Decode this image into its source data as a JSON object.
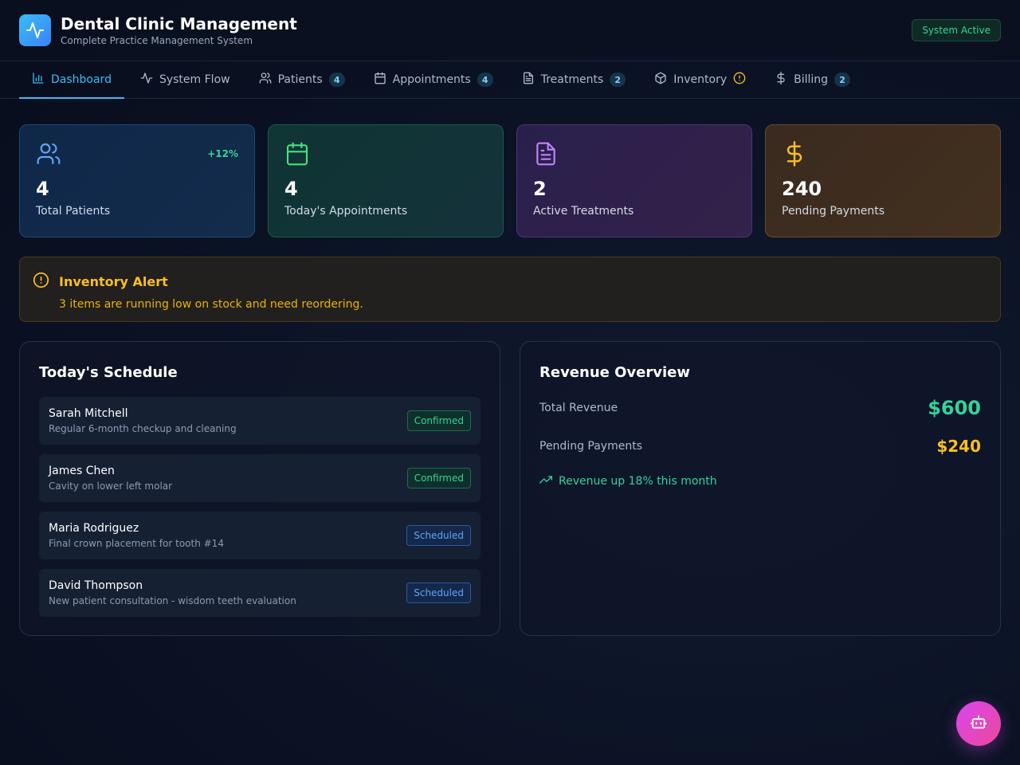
{
  "header": {
    "title": "Dental Clinic Management",
    "subtitle": "Complete Practice Management System",
    "status": "System Active",
    "logo_icon": "activity-icon"
  },
  "nav": {
    "tabs": [
      {
        "label": "Dashboard",
        "icon": "bar-chart-icon",
        "active": true
      },
      {
        "label": "System Flow",
        "icon": "activity-icon"
      },
      {
        "label": "Patients",
        "icon": "users-icon",
        "count": "4"
      },
      {
        "label": "Appointments",
        "icon": "calendar-icon",
        "count": "4"
      },
      {
        "label": "Treatments",
        "icon": "file-text-icon",
        "count": "2"
      },
      {
        "label": "Inventory",
        "icon": "package-icon",
        "alert_icon": "alert-circle-icon"
      },
      {
        "label": "Billing",
        "icon": "dollar-icon",
        "count": "2"
      }
    ]
  },
  "stats": [
    {
      "value": "4",
      "label": "Total Patients",
      "trend": "+12%",
      "icon": "users-icon",
      "color": "#60a5fa"
    },
    {
      "value": "4",
      "label": "Today's Appointments",
      "icon": "calendar-icon",
      "color": "#4ade80"
    },
    {
      "value": "2",
      "label": "Active Treatments",
      "icon": "file-text-icon",
      "color": "#c084fc"
    },
    {
      "value": "240",
      "label": "Pending Payments",
      "icon": "dollar-icon",
      "color": "#fbbf24"
    }
  ],
  "alert": {
    "title": "Inventory Alert",
    "text": "3 items are running low on stock and need reordering."
  },
  "schedule": {
    "title": "Today's Schedule",
    "items": [
      {
        "name": "Sarah Mitchell",
        "desc": "Regular 6-month checkup and cleaning",
        "status": "Confirmed"
      },
      {
        "name": "James Chen",
        "desc": "Cavity on lower left molar",
        "status": "Confirmed"
      },
      {
        "name": "Maria Rodriguez",
        "desc": "Final crown placement for tooth #14",
        "status": "Scheduled"
      },
      {
        "name": "David Thompson",
        "desc": "New patient consultation - wisdom teeth evaluation",
        "status": "Scheduled"
      }
    ]
  },
  "revenue": {
    "title": "Revenue Overview",
    "total_label": "Total Revenue",
    "total_value": "$600",
    "pending_label": "Pending Payments",
    "pending_value": "$240",
    "trend": "Revenue up 18% this month"
  },
  "fab": {
    "icon": "bot-icon"
  },
  "colors": {
    "accent": "#38bdf8",
    "success": "#34d399",
    "warning": "#fbbf24",
    "info": "#60a5fa"
  }
}
